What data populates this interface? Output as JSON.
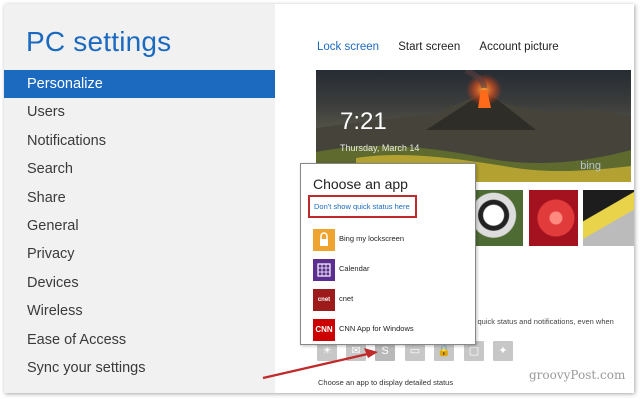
{
  "window": {
    "title": "PC settings"
  },
  "sidebar": {
    "items": [
      {
        "label": "Personalize",
        "active": true
      },
      {
        "label": "Users"
      },
      {
        "label": "Notifications"
      },
      {
        "label": "Search"
      },
      {
        "label": "Share"
      },
      {
        "label": "General"
      },
      {
        "label": "Privacy"
      },
      {
        "label": "Devices"
      },
      {
        "label": "Wireless"
      },
      {
        "label": "Ease of Access"
      },
      {
        "label": "Sync your settings"
      }
    ]
  },
  "tabs": [
    {
      "label": "Lock screen",
      "active": true
    },
    {
      "label": "Start screen"
    },
    {
      "label": "Account picture"
    }
  ],
  "lockscreen": {
    "time": "7:21",
    "date": "Thursday, March 14",
    "brand": "bing"
  },
  "quick_status": {
    "description_partial": "w quick status and notifications, even when",
    "caption": "Choose an app to display detailed status",
    "icons": [
      "sun-icon",
      "mail-icon",
      "skype-icon",
      "message-icon",
      "lock-icon",
      "chat-icon",
      "twitter-icon"
    ]
  },
  "popup": {
    "title": "Choose an app",
    "dont_show": "Don't show quick status here",
    "apps": [
      {
        "label": "Bing my lockscreen",
        "icon": "bing-lock-icon",
        "color": "#f0a430"
      },
      {
        "label": "Calendar",
        "icon": "calendar-icon",
        "color": "#5b2d91"
      },
      {
        "label": "cnet",
        "icon": "cnet-icon",
        "color": "#9e1b1b"
      },
      {
        "label": "CNN App for Windows",
        "icon": "cnn-icon",
        "color": "#cc0000"
      }
    ]
  },
  "watermark": "groovyPost.com",
  "colors": {
    "accent": "#1b6ac0",
    "highlight_box": "#c12a2a",
    "arrow": "#c12a2a"
  }
}
